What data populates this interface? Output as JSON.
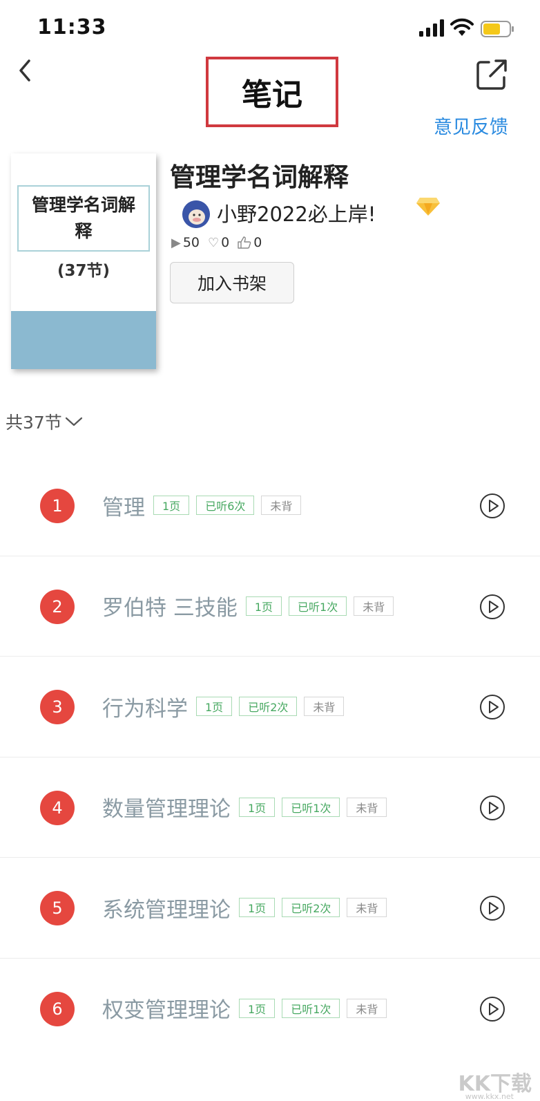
{
  "status_bar": {
    "time": "11:33"
  },
  "nav": {
    "title": "笔记",
    "feedback_label": "意见反馈"
  },
  "book": {
    "cover_title": "管理学名词解释",
    "cover_count": "(37节)",
    "title": "管理学名词解释",
    "author": "小野2022必上岸!",
    "plays": "50",
    "likes": "0",
    "thumbs": "0",
    "shelf_button": "加入书架"
  },
  "section_count": "共37节",
  "items": [
    {
      "num": "1",
      "title": "管理",
      "pages": "1页",
      "listened": "已听6次",
      "status": "未背"
    },
    {
      "num": "2",
      "title": "罗伯特 三技能",
      "pages": "1页",
      "listened": "已听1次",
      "status": "未背"
    },
    {
      "num": "3",
      "title": "行为科学",
      "pages": "1页",
      "listened": "已听2次",
      "status": "未背"
    },
    {
      "num": "4",
      "title": "数量管理理论",
      "pages": "1页",
      "listened": "已听1次",
      "status": "未背"
    },
    {
      "num": "5",
      "title": "系统管理理论",
      "pages": "1页",
      "listened": "已听2次",
      "status": "未背"
    },
    {
      "num": "6",
      "title": "权变管理理论",
      "pages": "1页",
      "listened": "已听1次",
      "status": "未背"
    }
  ],
  "watermark": {
    "text": "KK下载",
    "url": "www.kkx.net"
  },
  "colors": {
    "accent_red": "#e5473f",
    "link_blue": "#2b8be0",
    "tag_green": "#46a860"
  }
}
